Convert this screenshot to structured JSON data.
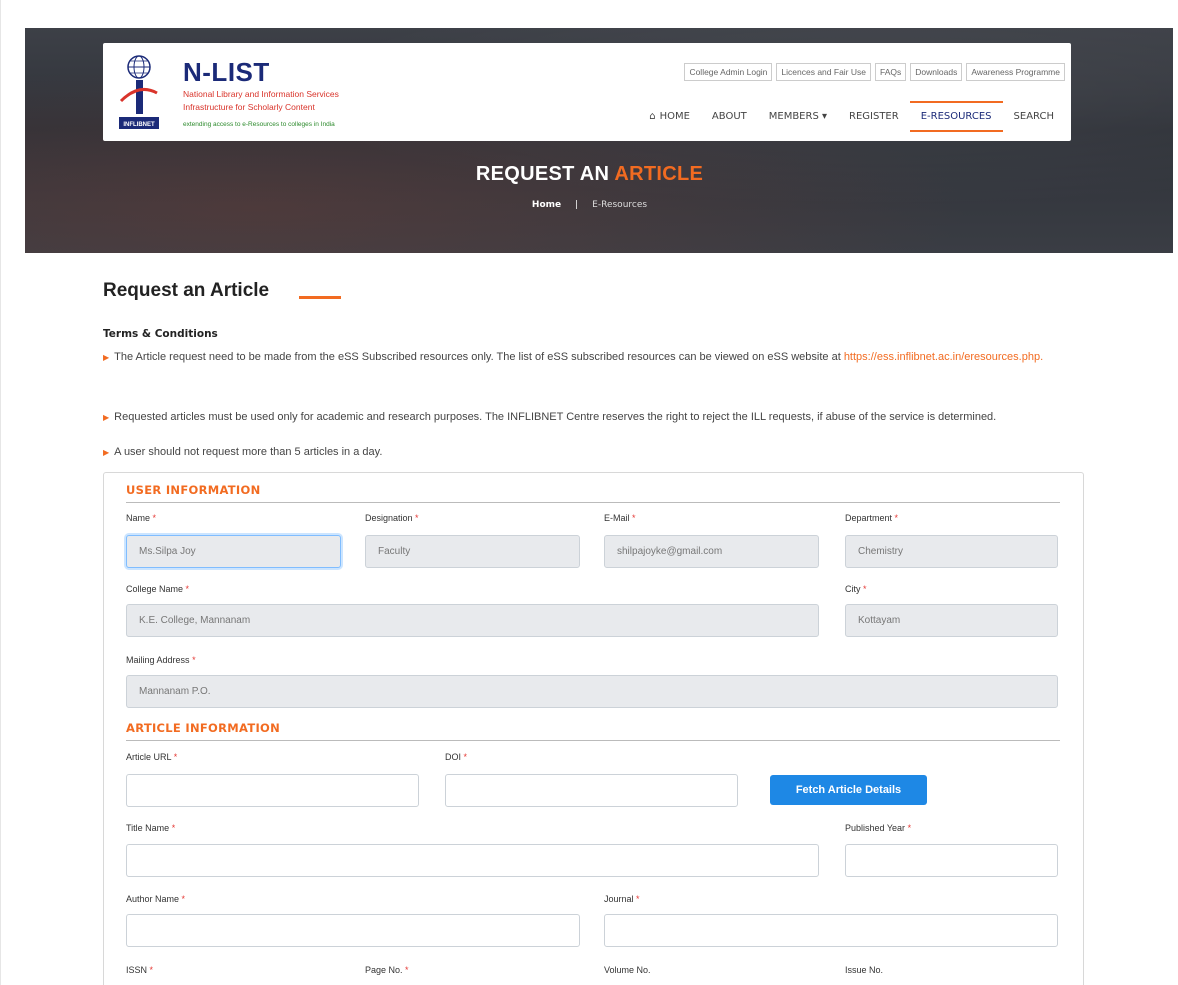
{
  "header": {
    "logo": {
      "title": "N-LIST",
      "line1": "National Library and Information Services",
      "line2": "Infrastructure for Scholarly Content",
      "tagline": "extending access to e-Resources to colleges in India",
      "badge": "INFLIBNET"
    },
    "top_links": [
      "College Admin Login",
      "Licences and Fair Use",
      "FAQs",
      "Downloads",
      "Awareness Programme"
    ],
    "nav": {
      "home": "HOME",
      "about": "ABOUT",
      "members": "MEMBERS ▾",
      "register": "REGISTER",
      "eresources": "E-RESOURCES",
      "search": "SEARCH"
    },
    "hero_title_white": "REQUEST AN",
    "hero_title_orange": "ARTICLE",
    "breadcrumb": {
      "home": "Home",
      "sep": "|",
      "current": "E-Resources"
    }
  },
  "page": {
    "title": "Request an Article",
    "terms_heading": "Terms & Conditions",
    "terms": [
      {
        "text": "The Article request need to be made from the eSS Subscribed resources only. The list of eSS subscribed resources can be viewed on eSS website at ",
        "link": "https://ess.inflibnet.ac.in/eresources.php."
      },
      {
        "text": "Requested articles must be used only for academic and research purposes. The INFLIBNET Centre reserves the right to reject the ILL requests, if abuse of the service is determined."
      },
      {
        "text": "A user should not request more than 5 articles in a day."
      }
    ]
  },
  "form": {
    "user_section": "USER INFORMATION",
    "article_section": "ARTICLE INFORMATION",
    "required_mark": "*",
    "labels": {
      "name": "Name",
      "designation": "Designation",
      "email": "E-Mail",
      "department": "Department",
      "college": "College Name",
      "city": "City",
      "address": "Mailing Address",
      "article_url": "Article URL",
      "doi": "DOI",
      "title": "Title Name",
      "year": "Published Year",
      "author": "Author Name",
      "journal": "Journal",
      "issn": "ISSN",
      "page": "Page No.",
      "volume": "Volume No.",
      "issue": "Issue No."
    },
    "values": {
      "name": "Ms.Silpa Joy",
      "designation": "Faculty",
      "email": "shilpajoyke@gmail.com",
      "department": "Chemistry",
      "college": "K.E. College, Mannanam",
      "city": "Kottayam",
      "address": "Mannanam P.O."
    },
    "fetch_button": "Fetch Article Details"
  }
}
